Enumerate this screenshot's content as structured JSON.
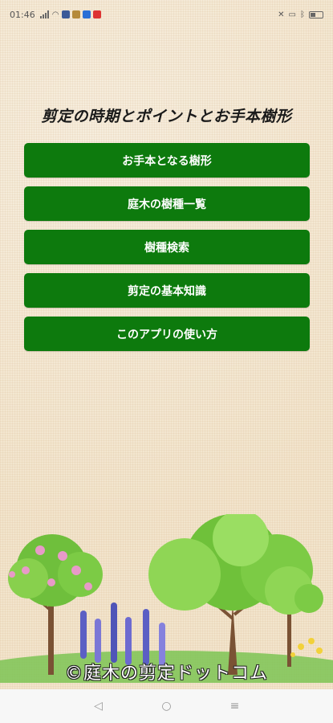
{
  "status_bar": {
    "time": "01:46",
    "right_text": "",
    "icons": [
      "signal-icon",
      "wifi-icon",
      "facebook-icon",
      "app-icon",
      "app-icon",
      "app-icon",
      "mute-icon",
      "bluetooth-icon",
      "battery-icon"
    ]
  },
  "page": {
    "title": "剪定の時期とポイントとお手本樹形"
  },
  "menu": {
    "items": [
      {
        "label": "お手本となる樹形"
      },
      {
        "label": "庭木の樹種一覧"
      },
      {
        "label": "樹種検索"
      },
      {
        "label": "剪定の基本知識"
      },
      {
        "label": "このアプリの使い方"
      }
    ]
  },
  "footer": {
    "copyright": "©庭木の剪定ドットコム"
  },
  "colors": {
    "button_bg": "#0d7a0d",
    "button_text": "#ffffff",
    "background": "#f2e4cc"
  }
}
